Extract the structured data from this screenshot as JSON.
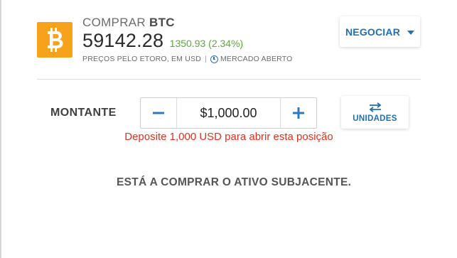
{
  "colors": {
    "accent": "#1f6fb5",
    "positive_change": "#5ca93a",
    "warning": "#e0301e",
    "coin_background": "#f7a21b"
  },
  "header": {
    "coin_icon": "bitcoin-icon",
    "action_verb": "COMPRAR",
    "symbol": "BTC",
    "price": "59142.28",
    "change": "1350.93 (2.34%)",
    "pricing_source": "PREÇOS PELO ETORO, EM USD",
    "separator": "|",
    "market_status": "MERCADO ABERTO"
  },
  "trade_dropdown": {
    "label": "NEGOCIAR",
    "icon": "chevron-down-icon"
  },
  "amount": {
    "label": "MONTANTE",
    "value": "$1,000.00",
    "minus_icon": "minus-icon",
    "plus_icon": "plus-icon"
  },
  "units_button": {
    "label": "UNIDADES",
    "icon": "swap-arrows-icon"
  },
  "warning_message": "Deposite 1,000 USD para abrir esta posição",
  "info_message": "ESTÁ A COMPRAR O ATIVO SUBJACENTE."
}
